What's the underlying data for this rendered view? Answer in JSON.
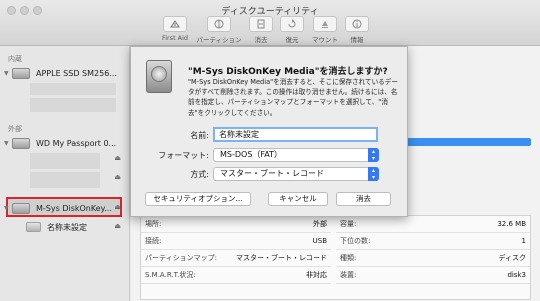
{
  "window": {
    "title": "ディスクユーティリティ"
  },
  "toolbar": [
    {
      "label": "First Aid",
      "icon": "first-aid-icon"
    },
    {
      "label": "パーティション",
      "icon": "partition-icon"
    },
    {
      "label": "消去",
      "icon": "erase-icon"
    },
    {
      "label": "復元",
      "icon": "restore-icon"
    },
    {
      "label": "マウント",
      "icon": "mount-icon"
    },
    {
      "label": "情報",
      "icon": "info-icon"
    }
  ],
  "sidebar": {
    "internal_header": "内蔵",
    "external_header": "外部",
    "internal_disk": "APPLE SSD SM256...",
    "external_disk": "WD My Passport 0...",
    "selected_disk": "M-Sys DiskOnKey...",
    "selected_volume": "名称未設定"
  },
  "info": {
    "rows": [
      {
        "left_key": "場所:",
        "left_value": "外部",
        "right_key": "容量:",
        "right_value": "32.6 MB"
      },
      {
        "left_key": "接続:",
        "left_value": "USB",
        "right_key": "下位の数:",
        "right_value": "1"
      },
      {
        "left_key": "パーティションマップ:",
        "left_value": "マスター・ブート・レコード",
        "right_key": "種類:",
        "right_value": "ディスク"
      },
      {
        "left_key": "S.M.A.R.T.状況:",
        "left_value": "非対応",
        "right_key": "装置:",
        "right_value": "disk3"
      }
    ]
  },
  "dialog": {
    "title": "\"M-Sys DiskOnKey Media\"を消去しますか?",
    "description": "\"M-Sys DiskOnKey Media\"を消去すると、そこに保存されているデータがすべて削除されます。この操作は取り消せません。続けるには、名前を指定し、パーティションマップとフォーマットを選択して、\"消去\"をクリックしてください。",
    "name_label": "名前:",
    "name_value": "名称未設定",
    "format_label": "フォーマット:",
    "format_value": "MS-DOS（FAT）",
    "scheme_label": "方式:",
    "scheme_value": "マスター・ブート・レコード",
    "security_button": "セキュリティオプション...",
    "cancel_button": "キャンセル",
    "erase_button": "消去"
  },
  "colors": {
    "accent": "#3478f6",
    "highlight": "#d6252b",
    "capacity_bar": "#3b8ff0"
  }
}
